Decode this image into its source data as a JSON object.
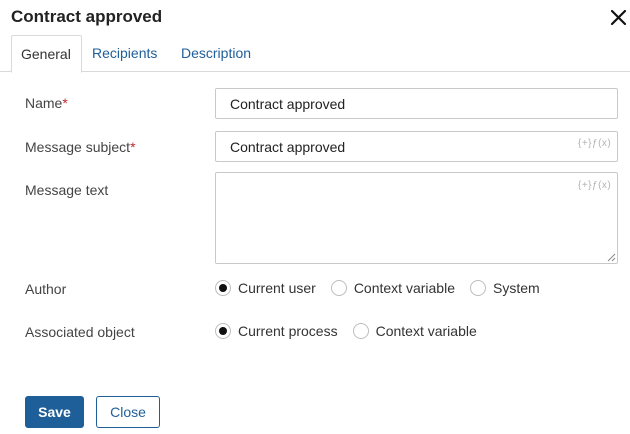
{
  "dialog": {
    "title": "Contract approved",
    "close_icon": "close-icon"
  },
  "tabs": [
    {
      "label": "General",
      "active": true
    },
    {
      "label": "Recipients",
      "active": false
    },
    {
      "label": "Description",
      "active": false
    }
  ],
  "form": {
    "name": {
      "label": "Name",
      "required_mark": "*",
      "value": "Contract approved"
    },
    "subject": {
      "label": "Message subject",
      "required_mark": "*",
      "value": "Contract approved",
      "insert_icon": "{+}ƒ(x)"
    },
    "text": {
      "label": "Message text",
      "value": "",
      "insert_icon": "{+}ƒ(x)"
    },
    "author": {
      "label": "Author",
      "options": [
        {
          "label": "Current user",
          "selected": true
        },
        {
          "label": "Context variable",
          "selected": false
        },
        {
          "label": "System",
          "selected": false
        }
      ]
    },
    "associated_object": {
      "label": "Associated object",
      "options": [
        {
          "label": "Current process",
          "selected": true
        },
        {
          "label": "Context variable",
          "selected": false
        }
      ]
    }
  },
  "buttons": {
    "save": "Save",
    "close": "Close"
  },
  "colors": {
    "accent": "#1f5f99",
    "required": "#c0282f",
    "border": "#c9c9c9"
  }
}
